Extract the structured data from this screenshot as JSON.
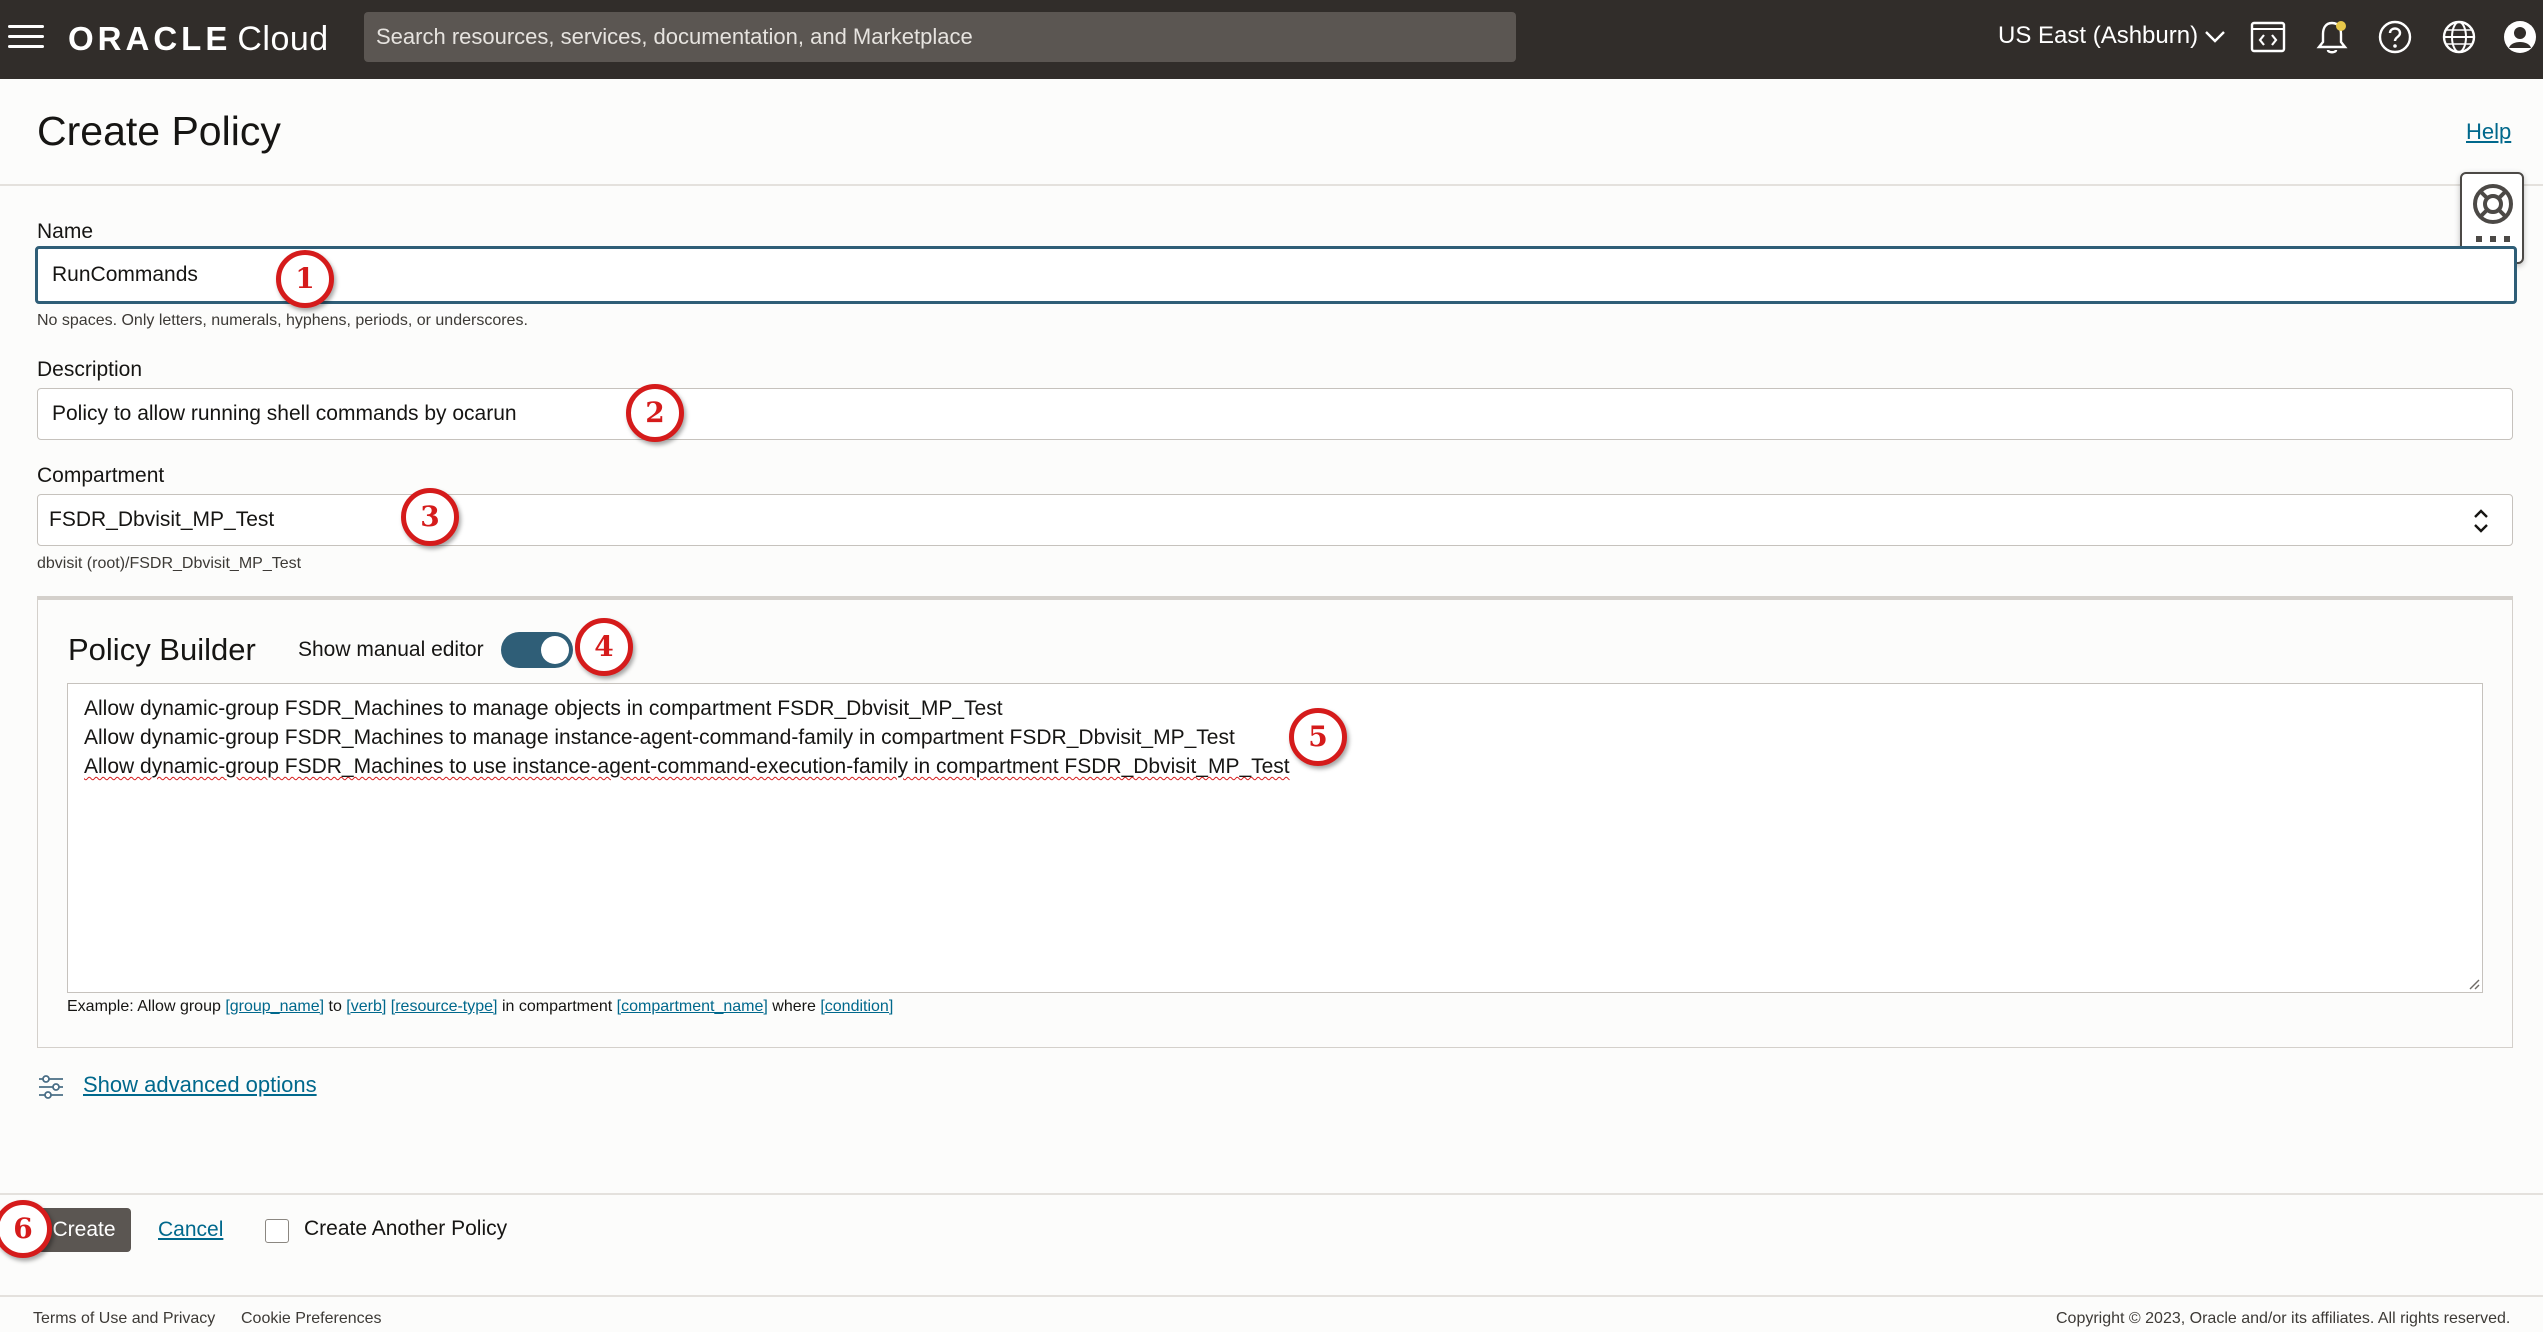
{
  "topbar": {
    "brand_name": "ORACLE",
    "brand_product": "Cloud",
    "search_placeholder": "Search resources, services, documentation, and Marketplace",
    "region": "US East (Ashburn)",
    "icons": [
      "code-editor-icon",
      "bell-icon",
      "help-icon",
      "globe-icon",
      "user-icon"
    ]
  },
  "page": {
    "title": "Create Policy",
    "help": "Help"
  },
  "form": {
    "name_label": "Name",
    "name_value": "RunCommands",
    "name_hint": "No spaces. Only letters, numerals, hyphens, periods, or underscores.",
    "description_label": "Description",
    "description_value": "Policy to allow running shell commands by ocarun",
    "compartment_label": "Compartment",
    "compartment_value": "FSDR_Dbvisit_MP_Test",
    "compartment_path": "dbvisit (root)/FSDR_Dbvisit_MP_Test"
  },
  "policy_builder": {
    "title": "Policy Builder",
    "manual_editor_label": "Show manual editor",
    "manual_editor_on": true,
    "statements": [
      "Allow dynamic-group FSDR_Machines to manage objects in compartment FSDR_Dbvisit_MP_Test",
      "Allow dynamic-group FSDR_Machines to manage instance-agent-command-family in compartment FSDR_Dbvisit_MP_Test",
      "Allow dynamic-group FSDR_Machines to use instance-agent-command-execution-family in compartment FSDR_Dbvisit_MP_Test"
    ],
    "example": {
      "prefix": "Example: Allow group",
      "group": "[group_name]",
      "to": "to",
      "verb": "[verb]",
      "resource": "[resource-type]",
      "in": "in compartment",
      "compartment": "[compartment_name]",
      "where": "where",
      "condition": "[condition]"
    }
  },
  "advanced": {
    "label": "Show advanced options"
  },
  "actions": {
    "create": "Create",
    "cancel": "Cancel",
    "create_another": "Create Another Policy"
  },
  "footer": {
    "terms": "Terms of Use and Privacy",
    "cookies": "Cookie Preferences",
    "copyright": "Copyright © 2023, Oracle and/or its affiliates. All rights reserved."
  },
  "annotations": [
    "1",
    "2",
    "3",
    "4",
    "5",
    "6"
  ],
  "colors": {
    "topbar": "#312d2a",
    "search": "#5b5652",
    "accent": "#2f5e77",
    "link": "#00688c",
    "badge": "#d51b1b"
  }
}
